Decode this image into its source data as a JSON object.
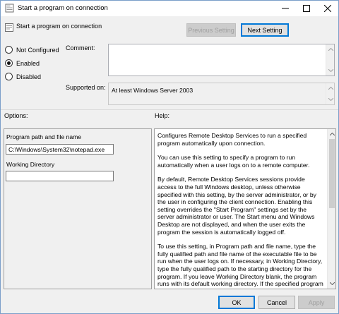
{
  "window": {
    "title": "Start a program on connection"
  },
  "header": {
    "setting_name": "Start a program on connection",
    "prev_label": "Previous Setting",
    "next_label": "Next Setting"
  },
  "state": {
    "options": [
      {
        "label": "Not Configured",
        "checked": false
      },
      {
        "label": "Enabled",
        "checked": true
      },
      {
        "label": "Disabled",
        "checked": false
      }
    ]
  },
  "comment": {
    "label": "Comment:",
    "value": ""
  },
  "supported": {
    "label": "Supported on:",
    "value": "At least Windows Server 2003"
  },
  "sections": {
    "options_label": "Options:",
    "help_label": "Help:"
  },
  "options": {
    "program_label": "Program path and file name",
    "program_value": "C:\\Windows\\System32\\notepad.exe",
    "workdir_label": "Working Directory",
    "workdir_value": ""
  },
  "help": {
    "paragraphs": [
      "Configures Remote Desktop Services to run a specified program automatically upon connection.",
      "You can use this setting to specify a program to run automatically when a user logs on to a remote computer.",
      "By default, Remote Desktop Services sessions provide access to the full Windows desktop, unless otherwise specified with this setting, by the server administrator, or by the user in configuring the client connection. Enabling this setting overrides the \"Start Program\" settings set by the server administrator or user. The Start menu and Windows Desktop are not displayed, and when the user exits the program the session is automatically logged off.",
      "To use this setting, in Program path and file name, type the fully qualified path and file name of the executable file to be run when the user logs on. If necessary, in Working Directory, type the fully qualified path to the starting directory for the program. If you leave Working Directory blank, the program runs with its default working directory. If the specified program path, file name, or"
    ]
  },
  "footer": {
    "ok_label": "OK",
    "cancel_label": "Cancel",
    "apply_label": "Apply"
  }
}
